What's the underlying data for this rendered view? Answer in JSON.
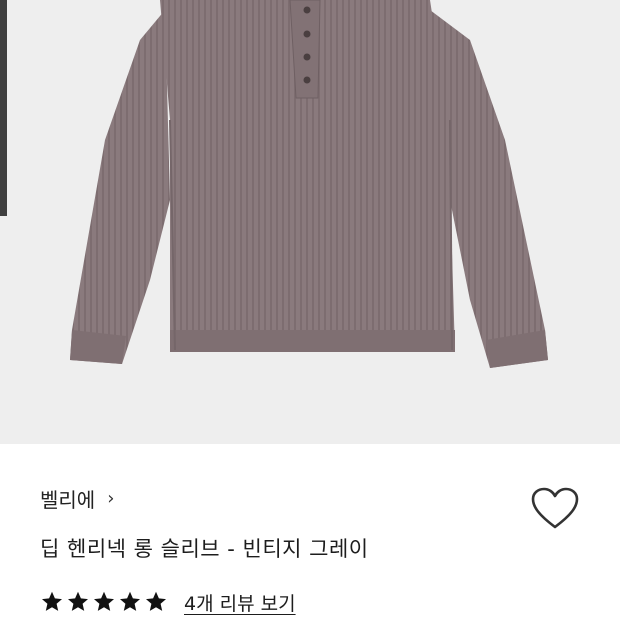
{
  "product": {
    "brand": "벨리에",
    "brand_chevron": "›",
    "title": "딥 헨리넥 롱 슬리브 - 빈티지 그레이",
    "rating_stars": 5,
    "review_link": "4개 리뷰 보기",
    "wish_icon": "heart-outline-icon",
    "star_icon": "star-filled-icon"
  },
  "colors": {
    "image_background": "#eeeeee",
    "garment": "#8a7a7d",
    "star": "#111111",
    "text": "#1d1d1d"
  }
}
